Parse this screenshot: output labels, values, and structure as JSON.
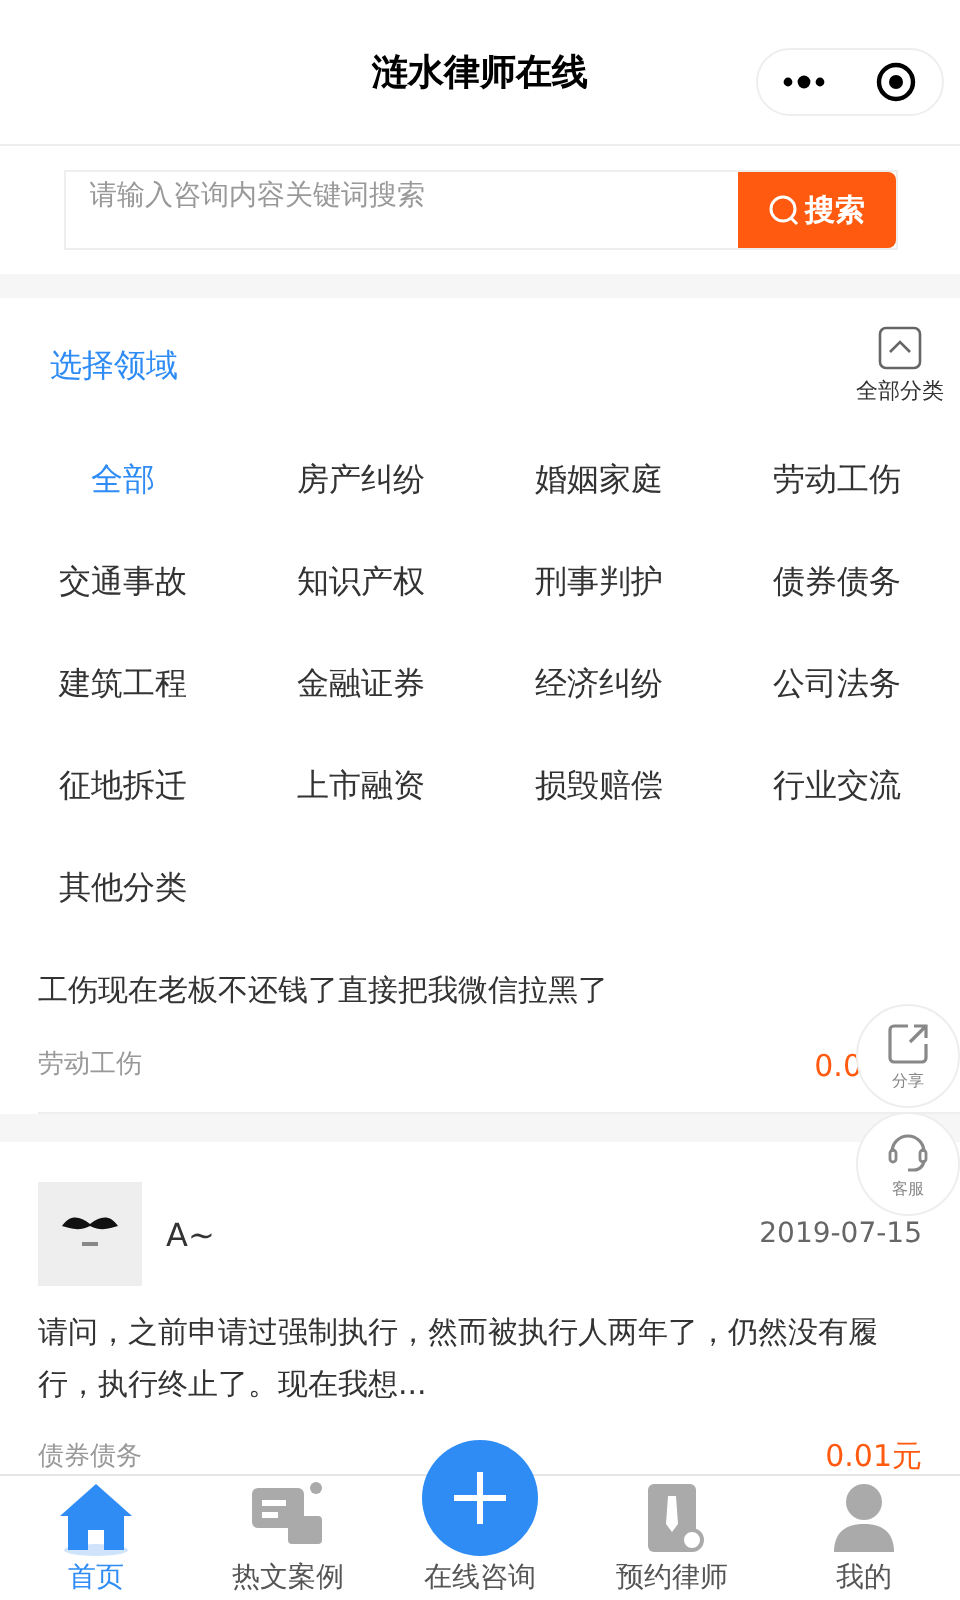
{
  "header": {
    "title": "涟水律师在线"
  },
  "search": {
    "placeholder": "请输入咨询内容关键词搜索",
    "button": "搜索"
  },
  "filter": {
    "title": "选择领域",
    "toggle": "全部分类",
    "expanded": true
  },
  "categories": [
    {
      "label": "全部",
      "selected": true
    },
    {
      "label": "房产纠纷",
      "selected": false
    },
    {
      "label": "婚姻家庭",
      "selected": false
    },
    {
      "label": "劳动工伤",
      "selected": false
    },
    {
      "label": "交通事故",
      "selected": false
    },
    {
      "label": "知识产权",
      "selected": false
    },
    {
      "label": "刑事判护",
      "selected": false
    },
    {
      "label": "债券债务",
      "selected": false
    },
    {
      "label": "建筑工程",
      "selected": false
    },
    {
      "label": "金融证券",
      "selected": false
    },
    {
      "label": "经济纠纷",
      "selected": false
    },
    {
      "label": "公司法务",
      "selected": false
    },
    {
      "label": "征地拆迁",
      "selected": false
    },
    {
      "label": "上市融资",
      "selected": false
    },
    {
      "label": "损毁赔偿",
      "selected": false
    },
    {
      "label": "行业交流",
      "selected": false
    },
    {
      "label": "其他分类",
      "selected": false
    }
  ],
  "posts": [
    {
      "kind": "plain",
      "question": "工伤现在老板不还钱了直接把我微信拉黑了",
      "category": "劳动工伤",
      "price": "0.0"
    },
    {
      "kind": "user",
      "user": "A~",
      "date": "2019-07-15",
      "question": "请问，之前申请过强制执行，然而被执行人两年了，仍然没有履行，执行终止了。现在我想...",
      "category": "债券债务",
      "price": "0.01元"
    }
  ],
  "floating": [
    {
      "kind": "share",
      "label": "分享"
    },
    {
      "kind": "service",
      "label": "客服"
    }
  ],
  "tabbar": [
    {
      "kind": "home",
      "label": "首页",
      "selected": true
    },
    {
      "kind": "cases",
      "label": "热文案例",
      "selected": false
    },
    {
      "kind": "plus",
      "label": "在线咨询",
      "selected": false
    },
    {
      "kind": "lawyer",
      "label": "预约律师",
      "selected": false
    },
    {
      "kind": "me",
      "label": "我的",
      "selected": false
    }
  ]
}
